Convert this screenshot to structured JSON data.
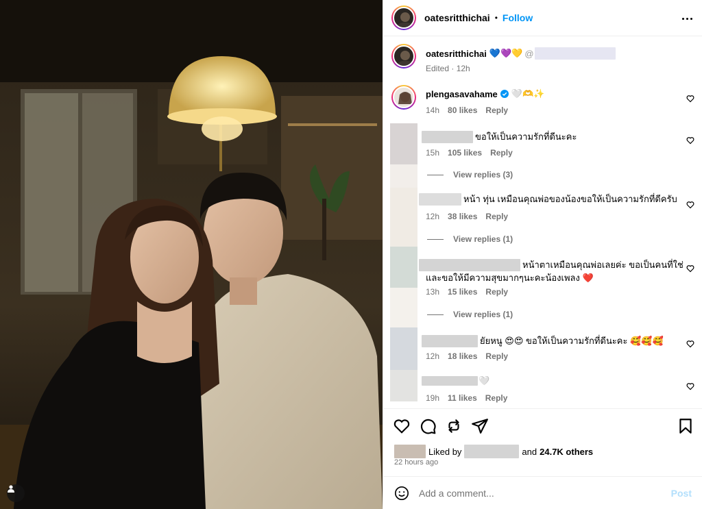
{
  "post": {
    "author": "oatesritthichai",
    "follow_label": "Follow",
    "caption_emojis": "💙💜💛",
    "caption_prefix": "@",
    "edited_time": "Edited · 12h"
  },
  "comments": [
    {
      "user": "plengasavahame",
      "verified": true,
      "text": "🤍🫶✨",
      "time": "14h",
      "likes": "80 likes",
      "reply_label": "Reply"
    },
    {
      "user": "",
      "text": "ขอให้เป็นความรักที่ดีนะคะ",
      "time": "15h",
      "likes": "105 likes",
      "reply_label": "Reply",
      "view_replies": "View replies (3)"
    },
    {
      "user": "",
      "text": "หน้า ทุ่น เหมือนคุณพ่อของน้องขอให้เป็นความรักที่ดีครับ",
      "time": "12h",
      "likes": "38 likes",
      "reply_label": "Reply",
      "view_replies": "View replies (1)"
    },
    {
      "user": "",
      "text_line1": "หน้าตาเหมือนคุณพ่อเลยค่ะ ขอเป็นคนที่ใช่",
      "text_line2": "และขอให้มีความสุขมากๆนะคะน้องเพลง ❤️",
      "time": "13h",
      "likes": "15 likes",
      "reply_label": "Reply",
      "view_replies": "View replies (1)"
    },
    {
      "user": "",
      "text": "ยัยหนู 😍😍 ขอให้เป็นความรักที่ดีนะคะ 🥰🥰🥰",
      "time": "12h",
      "likes": "18 likes",
      "reply_label": "Reply"
    },
    {
      "user": "",
      "text": "🤍",
      "time": "19h",
      "likes": "11 likes",
      "reply_label": "Reply"
    }
  ],
  "footer": {
    "liked_by_label": "Liked by",
    "and_label": "and",
    "others": "24.7K others",
    "time_ago": "22 hours ago",
    "add_comment_placeholder": "Add a comment...",
    "post_label": "Post"
  },
  "colors": {
    "link": "#0095f6",
    "meta": "#737373",
    "post_disabled": "#b2dffc",
    "divider": "#efefef"
  },
  "icons": [
    "heart-icon",
    "comment-icon",
    "share-icon",
    "send-icon",
    "bookmark-icon",
    "emoji-icon",
    "more-icon",
    "verified-icon",
    "tag-user-icon"
  ]
}
